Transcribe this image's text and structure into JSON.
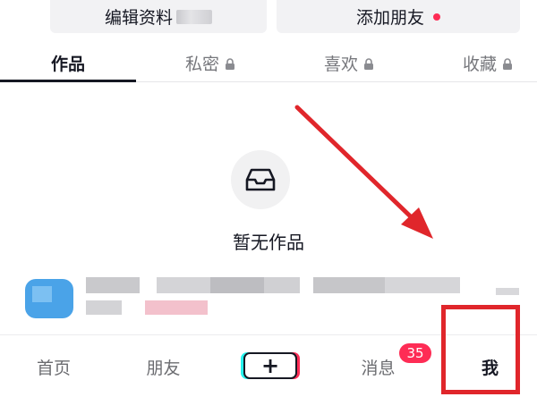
{
  "header": {
    "edit_profile_label": "编辑资料",
    "add_friend_label": "添加朋友"
  },
  "tabs": [
    {
      "label": "作品",
      "active": true,
      "locked": false
    },
    {
      "label": "私密",
      "active": false,
      "locked": true
    },
    {
      "label": "喜欢",
      "active": false,
      "locked": true
    },
    {
      "label": "收藏",
      "active": false,
      "locked": true
    }
  ],
  "empty_state": {
    "icon": "inbox-icon",
    "text": "暂无作品"
  },
  "bottom_nav": {
    "home_label": "首页",
    "friends_label": "朋友",
    "create_label": "+",
    "messages_label": "消息",
    "messages_badge": "35",
    "me_label": "我"
  },
  "colors": {
    "accent": "#fe2c55",
    "annotation": "#e0262b",
    "text_primary": "#161823",
    "text_secondary": "#76777c"
  }
}
